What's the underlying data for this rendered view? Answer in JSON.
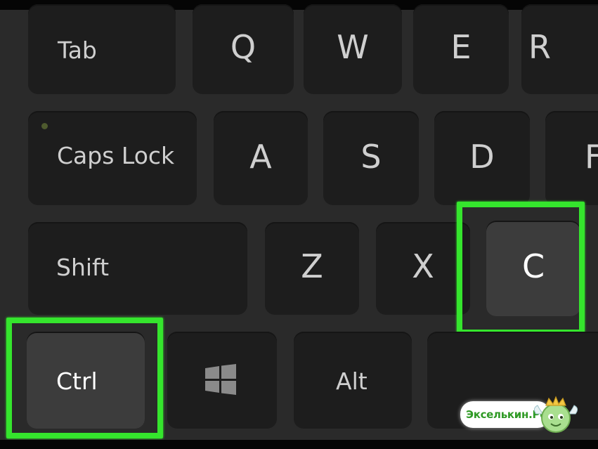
{
  "keys": {
    "tab": "Tab",
    "q": "Q",
    "w": "W",
    "e": "E",
    "r": "R",
    "caps_lock": "Caps Lock",
    "a": "A",
    "s": "S",
    "d": "D",
    "f": "F",
    "shift": "Shift",
    "z": "Z",
    "x": "X",
    "c": "C",
    "ctrl": "Ctrl",
    "alt": "Alt",
    "windows_icon": "windows-logo-icon"
  },
  "highlight": {
    "color": "#35e52d",
    "highlighted_keys": [
      "Ctrl",
      "C"
    ]
  },
  "watermark": {
    "text": "Экселькин.Рф"
  },
  "colors": {
    "keyboard_base": "#2a2a2a",
    "key_face": "#1d1d1d",
    "key_face_highlighted": "#3c3c3c",
    "label": "#cfcfcf"
  }
}
